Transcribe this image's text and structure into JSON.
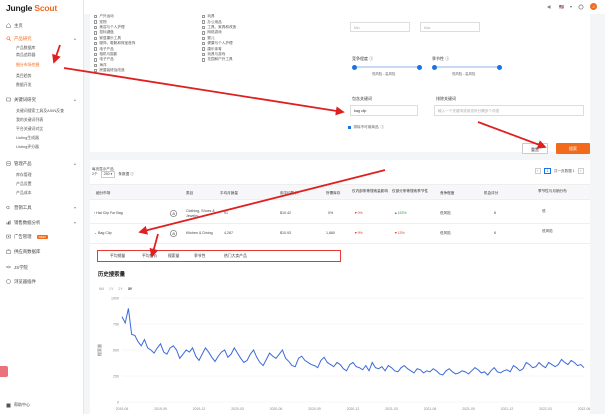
{
  "brand": {
    "part1": "Jungle",
    "part2": "Scout"
  },
  "sidebar": {
    "items": [
      {
        "label": "主页",
        "icon": "home-icon"
      },
      {
        "label": "产品研究",
        "icon": "product-research-icon",
        "sub": [
          "产品数据库",
          "商品追踪器",
          "细分市场挖掘",
          "类目趋势",
          "数据开发"
        ]
      },
      {
        "label": "关键词研究",
        "icon": "keyword-icon",
        "sub": [
          "关键词搜索工具及ASIN反查",
          "我的关键词列表",
          "平台关键词对比",
          "Listing生成器",
          "Listing评分器"
        ]
      },
      {
        "label": "管理产品",
        "icon": "manage-icon",
        "sub": [
          "库存管理",
          "产品设置",
          "产品成本"
        ]
      },
      {
        "label": "营销工具",
        "icon": "marketing-icon"
      },
      {
        "label": "销售数据分析",
        "icon": "analytics-icon"
      },
      {
        "label": "广告管理",
        "icon": "ads-icon",
        "badge": "NEW"
      },
      {
        "label": "供应商数据库",
        "icon": "supplier-icon"
      },
      {
        "label": "JS学院",
        "icon": "academy-icon"
      },
      {
        "label": "浏览器插件",
        "icon": "extension-icon"
      }
    ],
    "bottom": "帮助中心"
  },
  "filters": {
    "col1": [
      "户外运动",
      "宠物",
      "美容与个人护理",
      "鼠标键盘",
      "家居康乐工具",
      "服饰、鞋靴和珠宝首饰",
      "电子产品",
      "相机与摄影",
      "电子产品",
      "海洋",
      "房屋装修及改造"
    ],
    "col2": [
      "玩具",
      "办公用品",
      "工具、家具和改造",
      "网络游戏",
      "婴儿",
      "健康与个人护理",
      "康乐体育",
      "玩具与游戏",
      "花园和户外工具"
    ],
    "range_placeholders": [
      "Min",
      "Max"
    ],
    "competition_label": "竞争程度",
    "competition_range": "低风险 - 高风险",
    "seasonality_label": "季节性",
    "seasonality_range": "低风险 - 高风险",
    "include_kw_label": "包含关键词",
    "include_kw_value": "bag clip",
    "exclude_kw_label": "排除关键词",
    "exclude_kw_placeholder": "输入一个关键词或用逗号分隔多个词语",
    "exclude_unavailable": "排除不可用商品",
    "reset_label": "重置",
    "search_label": "搜索"
  },
  "table": {
    "info_prefix": "每页显示产品",
    "info_count": "2个",
    "per_page": "250",
    "info_suffix": "条数据",
    "pager": {
      "prev": "‹",
      "page": "1",
      "total": "共一页数据 1",
      "next": "›"
    },
    "columns": [
      "细分市场",
      "类目",
      "平均月销量",
      "用平均售价",
      "所需库存",
      "仅内部条等搜索量影响",
      "仅部分条等搜索季节性",
      "竞争程度",
      "机会评分",
      "季节性与月销分布"
    ],
    "rows": [
      {
        "name": "Hat Clip For Bag",
        "category": "Clothing, Shoes & Jewelry",
        "sales": "91",
        "price": "$10.42",
        "stock": "0%",
        "v1": "0%",
        "v2": "153%",
        "competition": "低风险",
        "score": "8",
        "season": "低"
      },
      {
        "name": "Bag Clip",
        "category": "Kitchen & Dining",
        "sales": "4,267",
        "price": "$10.93",
        "stock": "1,680",
        "v1": "9%",
        "v2": "13%",
        "competition": "低风险",
        "score": "6",
        "season": "低风险"
      }
    ]
  },
  "detail_tabs": [
    "平均销量",
    "平均售价",
    "搜索量",
    "季节性",
    "热门大卖产品"
  ],
  "chart_section_title": "历史搜索量",
  "range_tabs": [
    "6M",
    "1Y",
    "2Y",
    "3Y"
  ],
  "range_active": "3Y",
  "topbar": {
    "flag": "🇺🇸",
    "avatar": "J"
  },
  "chart_data": {
    "type": "line",
    "title": "",
    "ylabel": "搜索量",
    "ylim": [
      0,
      1000
    ],
    "yticks": [
      0,
      250,
      500,
      750,
      1000
    ],
    "xticks": [
      "2019-06",
      "2019-09",
      "2019-12",
      "2020-03",
      "2020-06",
      "2020-09",
      "2020-12",
      "2021-03",
      "2021-06",
      "2021-09",
      "2021-12",
      "2022-03",
      "2022-06"
    ],
    "series": [
      {
        "name": "",
        "values": [
          820,
          760,
          900,
          650,
          640,
          580,
          540,
          600,
          520,
          500,
          470,
          520,
          560,
          480,
          460,
          520,
          540,
          500,
          420,
          460,
          500,
          480,
          520,
          440,
          400,
          460,
          520,
          480,
          430,
          390,
          440,
          480,
          500,
          430,
          460,
          520,
          470,
          420,
          380,
          400,
          460,
          500,
          430,
          380,
          350,
          410,
          470,
          440,
          420,
          460,
          500,
          420,
          390,
          350,
          340,
          420,
          440,
          400,
          380,
          360,
          350,
          330,
          400,
          430,
          380,
          360,
          340,
          380,
          360,
          320,
          300,
          360,
          380,
          340,
          330,
          310,
          350,
          300,
          380,
          330,
          320,
          340,
          300,
          350,
          330,
          300,
          290,
          330,
          350,
          320,
          300,
          280,
          320,
          310,
          280,
          300,
          290,
          320,
          300,
          270,
          260,
          300,
          320,
          290,
          270,
          280,
          300,
          290,
          270,
          300,
          330,
          310,
          280,
          290,
          260,
          300,
          330,
          290,
          280,
          300,
          310,
          290,
          350,
          330,
          300,
          320,
          380,
          360,
          330,
          340,
          380,
          350,
          330,
          380,
          360,
          340,
          360,
          410,
          380,
          360,
          400,
          380,
          350,
          360,
          330
        ]
      }
    ]
  }
}
